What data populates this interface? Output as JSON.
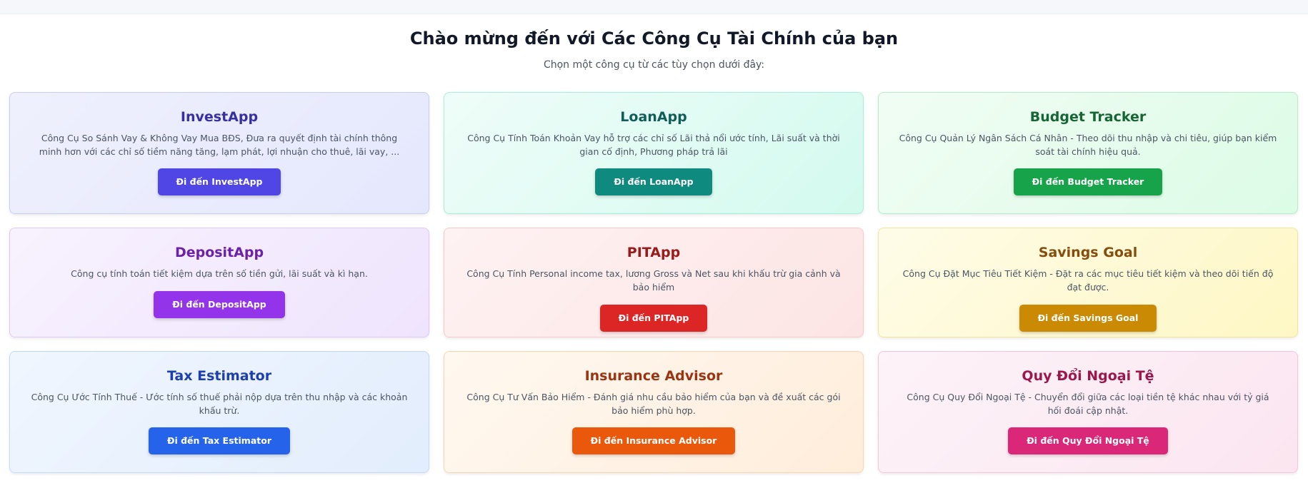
{
  "header": {
    "title": "Chào mừng đến với Các Công Cụ Tài Chính của bạn",
    "subtitle": "Chọn một công cụ từ các tùy chọn dưới đây:"
  },
  "cards": [
    {
      "title": "InvestApp",
      "description": "Công Cụ So Sánh Vay & Không Vay Mua BĐS, Đưa ra quyết định tài chính thông minh hơn với các chỉ số tiềm năng tăng, lạm phát, lợi nhuận cho thuê, lãi vay, ...",
      "button_label": "Đi đến InvestApp",
      "colors": {
        "bg_from": "#eef0fd",
        "bg_to": "#e5e8fd",
        "border": "#c7cdf8",
        "title": "#3730a3",
        "button": "#4f46e5"
      }
    },
    {
      "title": "LoanApp",
      "description": "Công Cụ Tính Toán Khoản Vay hỗ trợ các chỉ số Lãi thả nổi ước tính, Lãi suất và thời gian cố định, Phương pháp trả lãi",
      "button_label": "Đi đến LoanApp",
      "colors": {
        "bg_from": "#effdf9",
        "bg_to": "#d3faee",
        "border": "#a7f0dc",
        "title": "#115e59",
        "button": "#0f8a7e"
      }
    },
    {
      "title": "Budget Tracker",
      "description": "Công Cụ Quản Lý Ngân Sách Cá Nhân - Theo dõi thu nhập và chi tiêu, giúp bạn kiểm soát tài chính hiệu quả.",
      "button_label": "Đi đến Budget Tracker",
      "colors": {
        "bg_from": "#f1fdf4",
        "bg_to": "#dcfce6",
        "border": "#b5efc8",
        "title": "#166534",
        "button": "#16a34a"
      }
    },
    {
      "title": "DepositApp",
      "description": "Công cụ tính toán tiết kiệm dựa trên số tiền gửi, lãi suất và kì hạn.",
      "button_label": "Đi đến DepositApp",
      "colors": {
        "bg_from": "#f8f2fe",
        "bg_to": "#efe4fd",
        "border": "#dfc8f8",
        "title": "#6b21a8",
        "button": "#9333ea"
      }
    },
    {
      "title": "PITApp",
      "description": "Công Cụ Tính Personal income tax, lương Gross và Net sau khi khấu trừ gia cảnh và bảo hiểm",
      "button_label": "Đi đến PITApp",
      "colors": {
        "bg_from": "#fef2f2",
        "bg_to": "#fde4e4",
        "border": "#f7c9c9",
        "title": "#991b1b",
        "button": "#dc2626"
      }
    },
    {
      "title": "Savings Goal",
      "description": "Công Cụ Đặt Mục Tiêu Tiết Kiệm - Đặt ra các mục tiêu tiết kiệm và theo dõi tiến độ đạt được.",
      "button_label": "Đi đến Savings Goal",
      "colors": {
        "bg_from": "#fefce8",
        "bg_to": "#fef7c4",
        "border": "#f5e49a",
        "title": "#854d0e",
        "button": "#ca8a04"
      }
    },
    {
      "title": "Tax Estimator",
      "description": "Công Cụ Ước Tính Thuế - Ước tính số thuế phải nộp dựa trên thu nhập và các khoản khấu trừ.",
      "button_label": "Đi đến Tax Estimator",
      "colors": {
        "bg_from": "#f0f6fe",
        "bg_to": "#e2edfd",
        "border": "#c3d9f8",
        "title": "#1e40af",
        "button": "#2563eb"
      }
    },
    {
      "title": "Insurance Advisor",
      "description": "Công Cụ Tư Vấn Bảo Hiểm - Đánh giá nhu cầu bảo hiểm của bạn và đề xuất các gói bảo hiểm phù hợp.",
      "button_label": "Đi đến Insurance Advisor",
      "colors": {
        "bg_from": "#fff8f0",
        "bg_to": "#ffeddb",
        "border": "#fad6b0",
        "title": "#9a3412",
        "button": "#ea580c"
      }
    },
    {
      "title": "Quy Đổi Ngoại Tệ",
      "description": "Công Cụ Quy Đổi Ngoại Tệ - Chuyển đổi giữa các loại tiền tệ khác nhau với tỷ giá hối đoái cập nhật.",
      "button_label": "Đi đến Quy Đổi Ngoại Tệ",
      "colors": {
        "bg_from": "#fdf3f8",
        "bg_to": "#fbe5f0",
        "border": "#f4c6dc",
        "title": "#9d174d",
        "button": "#db2777"
      }
    }
  ]
}
